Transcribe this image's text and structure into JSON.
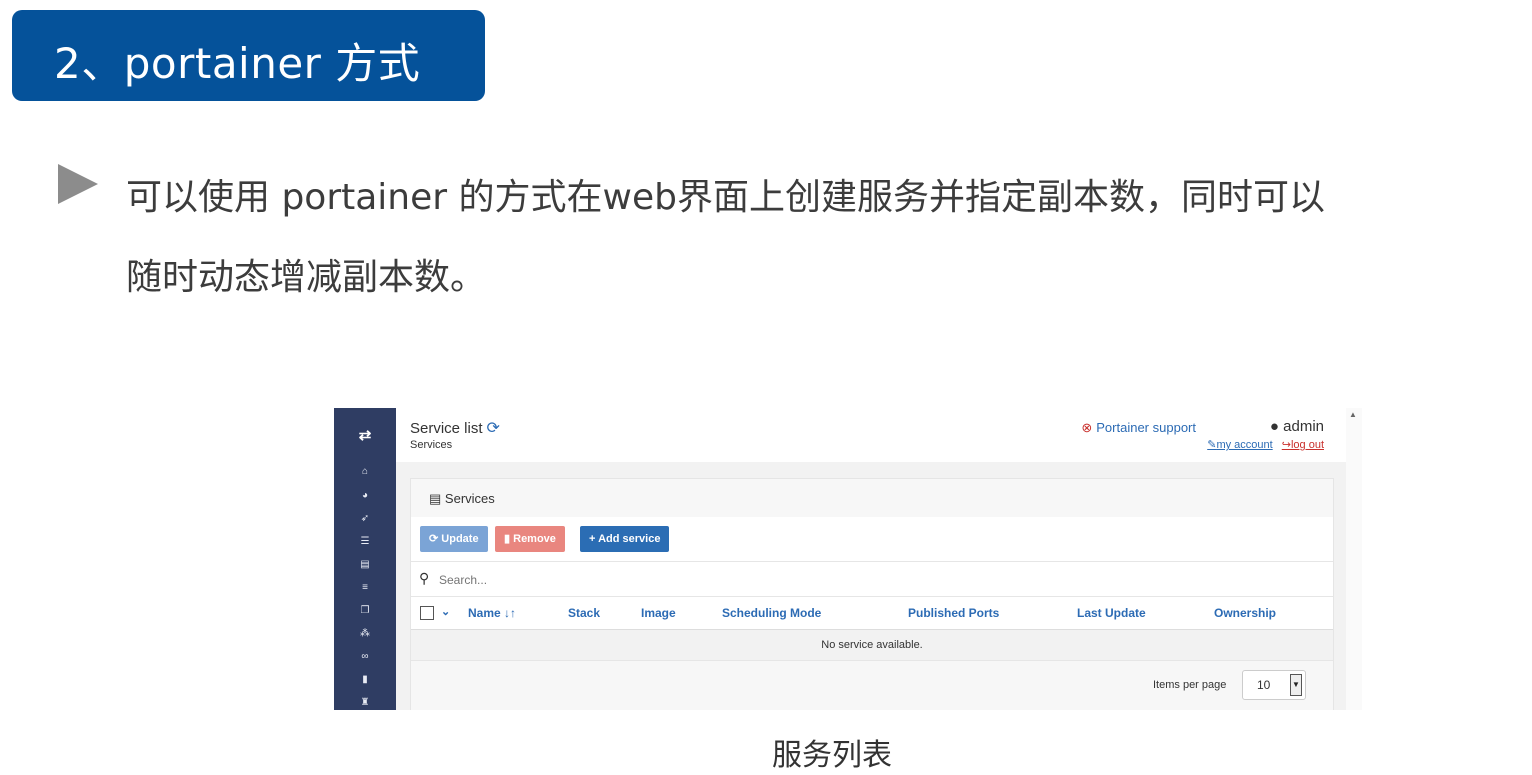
{
  "slide": {
    "heading": "2、portainer 方式",
    "body_line1": "可以使用 portainer 的方式在web界面上创建服务并指定副本数，同时可以",
    "body_line2": "随时动态增减副本数。",
    "caption": "服务列表"
  },
  "app": {
    "page_title": "Service list",
    "breadcrumb": "Services",
    "support_link": "Portainer support",
    "user": "admin",
    "my_account": "my account",
    "log_out": "log out",
    "sidebar_icons": [
      "toggle-icon",
      "home-icon",
      "dashboard-icon",
      "rocket-icon",
      "list-icon",
      "services-icon",
      "tasks-icon",
      "clone-icon",
      "network-icon",
      "volumes-icon",
      "file-icon",
      "registry-icon"
    ],
    "panel_title": "Services",
    "buttons": {
      "update": "Update",
      "remove": "Remove",
      "add": "Add service"
    },
    "search_placeholder": "Search...",
    "columns": [
      "Name",
      "Stack",
      "Image",
      "Scheduling Mode",
      "Published Ports",
      "Last Update",
      "Ownership"
    ],
    "empty_message": "No service available.",
    "items_per_page_label": "Items per page",
    "items_per_page_value": "10"
  },
  "colors": {
    "heading_bg": "#05529a",
    "sidebar": "#2f3d63",
    "primary": "#2b6db4",
    "danger": "#e9867f"
  }
}
